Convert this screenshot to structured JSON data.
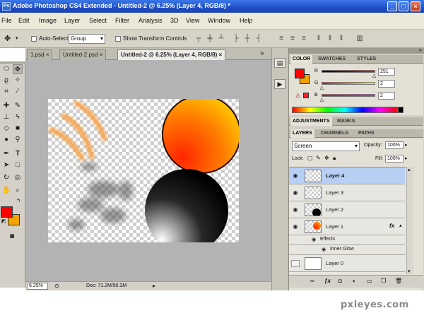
{
  "window": {
    "title": "Adobe Photoshop CS4 Extended - Untitled-2 @ 6.25% (Layer 4, RGB/8) *",
    "app_icon_label": "Ps"
  },
  "menu": [
    "File",
    "Edit",
    "Image",
    "Layer",
    "Select",
    "Filter",
    "Analysis",
    "3D",
    "View",
    "Window",
    "Help"
  ],
  "options": {
    "auto_select_label": "Auto-Select:",
    "auto_select_value": "Group",
    "show_transform_label": "Show Transform Controls"
  },
  "tabs": [
    {
      "label": "1.psd",
      "close": "×"
    },
    {
      "label": "Untitled-2.psd",
      "close": "×"
    },
    {
      "label": "Untitled-2 @ 6.25% (Layer 4, RGB/8)",
      "close": "×"
    }
  ],
  "tab_overflow": "»",
  "status": {
    "zoom": "6.25%",
    "doc": "Doc: 71.2M/90.3M"
  },
  "color_panel": {
    "tabs": [
      "COLOR",
      "SWATCHES",
      "STYLES"
    ],
    "r_label": "R",
    "g_label": "G",
    "b_label": "B",
    "r": "251",
    "g": "2",
    "b": "2",
    "r_fraction": 0.984,
    "g_fraction": 0.008,
    "b_fraction": 0.008
  },
  "adjustments_tabs": [
    "ADJUSTMENTS",
    "MASKS"
  ],
  "layers_panel": {
    "tabs": [
      "LAYERS",
      "CHANNELS",
      "PATHS"
    ],
    "blend_mode": "Screen",
    "opacity_label": "Opacity:",
    "opacity": "100%",
    "lock_label": "Lock:",
    "fill_label": "Fill:",
    "fill": "100%",
    "fx_label": "fx",
    "layers": [
      {
        "name": "Layer 4"
      },
      {
        "name": "Layer 3"
      },
      {
        "name": "Layer 2"
      },
      {
        "name": "Layer 1"
      },
      {
        "name": "Effects"
      },
      {
        "name": "Inner Glow"
      },
      {
        "name": "Layer 0"
      }
    ]
  },
  "watermark": "pxleyes.com",
  "colors": {
    "foreground": "#ff0000",
    "background": "#f5a300",
    "active_layer": "#b7cff5",
    "title_bar": "#1f4fc6"
  }
}
